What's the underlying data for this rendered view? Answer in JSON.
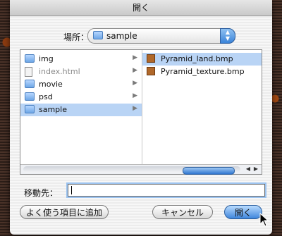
{
  "dialog": {
    "title": "開く"
  },
  "where": {
    "label": "場所：",
    "value": "sample"
  },
  "browser": {
    "column1": [
      {
        "name": "img",
        "type": "folder",
        "has_children": true
      },
      {
        "name": "index.html",
        "type": "document",
        "has_children": true,
        "dimmed": true
      },
      {
        "name": "movie",
        "type": "folder",
        "has_children": true
      },
      {
        "name": "psd",
        "type": "folder",
        "has_children": true
      },
      {
        "name": "sample",
        "type": "folder",
        "has_children": true,
        "selected": true
      }
    ],
    "column2": [
      {
        "name": "Pyramid_land.bmp",
        "type": "bmp",
        "selected": true
      },
      {
        "name": "Pyramid_texture.bmp",
        "type": "bmp"
      }
    ]
  },
  "destination": {
    "label": "移動先：",
    "value": ""
  },
  "buttons": {
    "add_favorites": "よく使う項目に追加",
    "cancel": "キャンセル",
    "open": "開く"
  },
  "colors": {
    "selection": "#b9d4f5",
    "accent": "#3f86dc"
  }
}
